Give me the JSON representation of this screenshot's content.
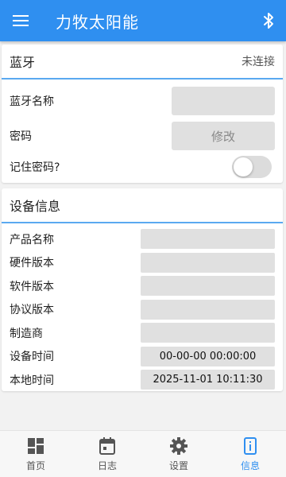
{
  "appbar": {
    "title": "力牧太阳能"
  },
  "bluetooth": {
    "title": "蓝牙",
    "status": "未连接",
    "name_label": "蓝牙名称",
    "name_value": "",
    "password_label": "密码",
    "modify_label": "修改",
    "remember_label": "记住密码?",
    "remember_on": false
  },
  "device": {
    "title": "设备信息",
    "rows": [
      {
        "label": "产品名称",
        "value": ""
      },
      {
        "label": "硬件版本",
        "value": ""
      },
      {
        "label": "软件版本",
        "value": ""
      },
      {
        "label": "协议版本",
        "value": ""
      },
      {
        "label": "制造商",
        "value": ""
      },
      {
        "label": "设备时间",
        "value": "00-00-00 00:00:00"
      },
      {
        "label": "本地时间",
        "value": "2025-11-01 10:11:30"
      }
    ]
  },
  "nav": {
    "items": [
      {
        "label": "首页",
        "icon": "dashboard-icon"
      },
      {
        "label": "日志",
        "icon": "calendar-icon"
      },
      {
        "label": "设置",
        "icon": "gear-icon"
      },
      {
        "label": "信息",
        "icon": "info-icon"
      }
    ],
    "active_index": 3
  },
  "colors": {
    "primary": "#2f8ff0",
    "divider": "#5aa9f0"
  }
}
